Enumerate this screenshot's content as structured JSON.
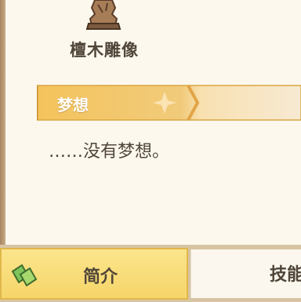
{
  "item": {
    "name": "檀木雕像",
    "icon": "wooden-statue-icon"
  },
  "section": {
    "title": "梦想",
    "description": "……没有梦想。"
  },
  "tabs": [
    {
      "label": "简介",
      "icon": "leaf-icon",
      "active": true
    },
    {
      "label": "技能",
      "active": false
    }
  ],
  "colors": {
    "banner_gold": "#f3c25a",
    "tab_active": "#f6d56a",
    "text_dark": "#4f4538"
  }
}
